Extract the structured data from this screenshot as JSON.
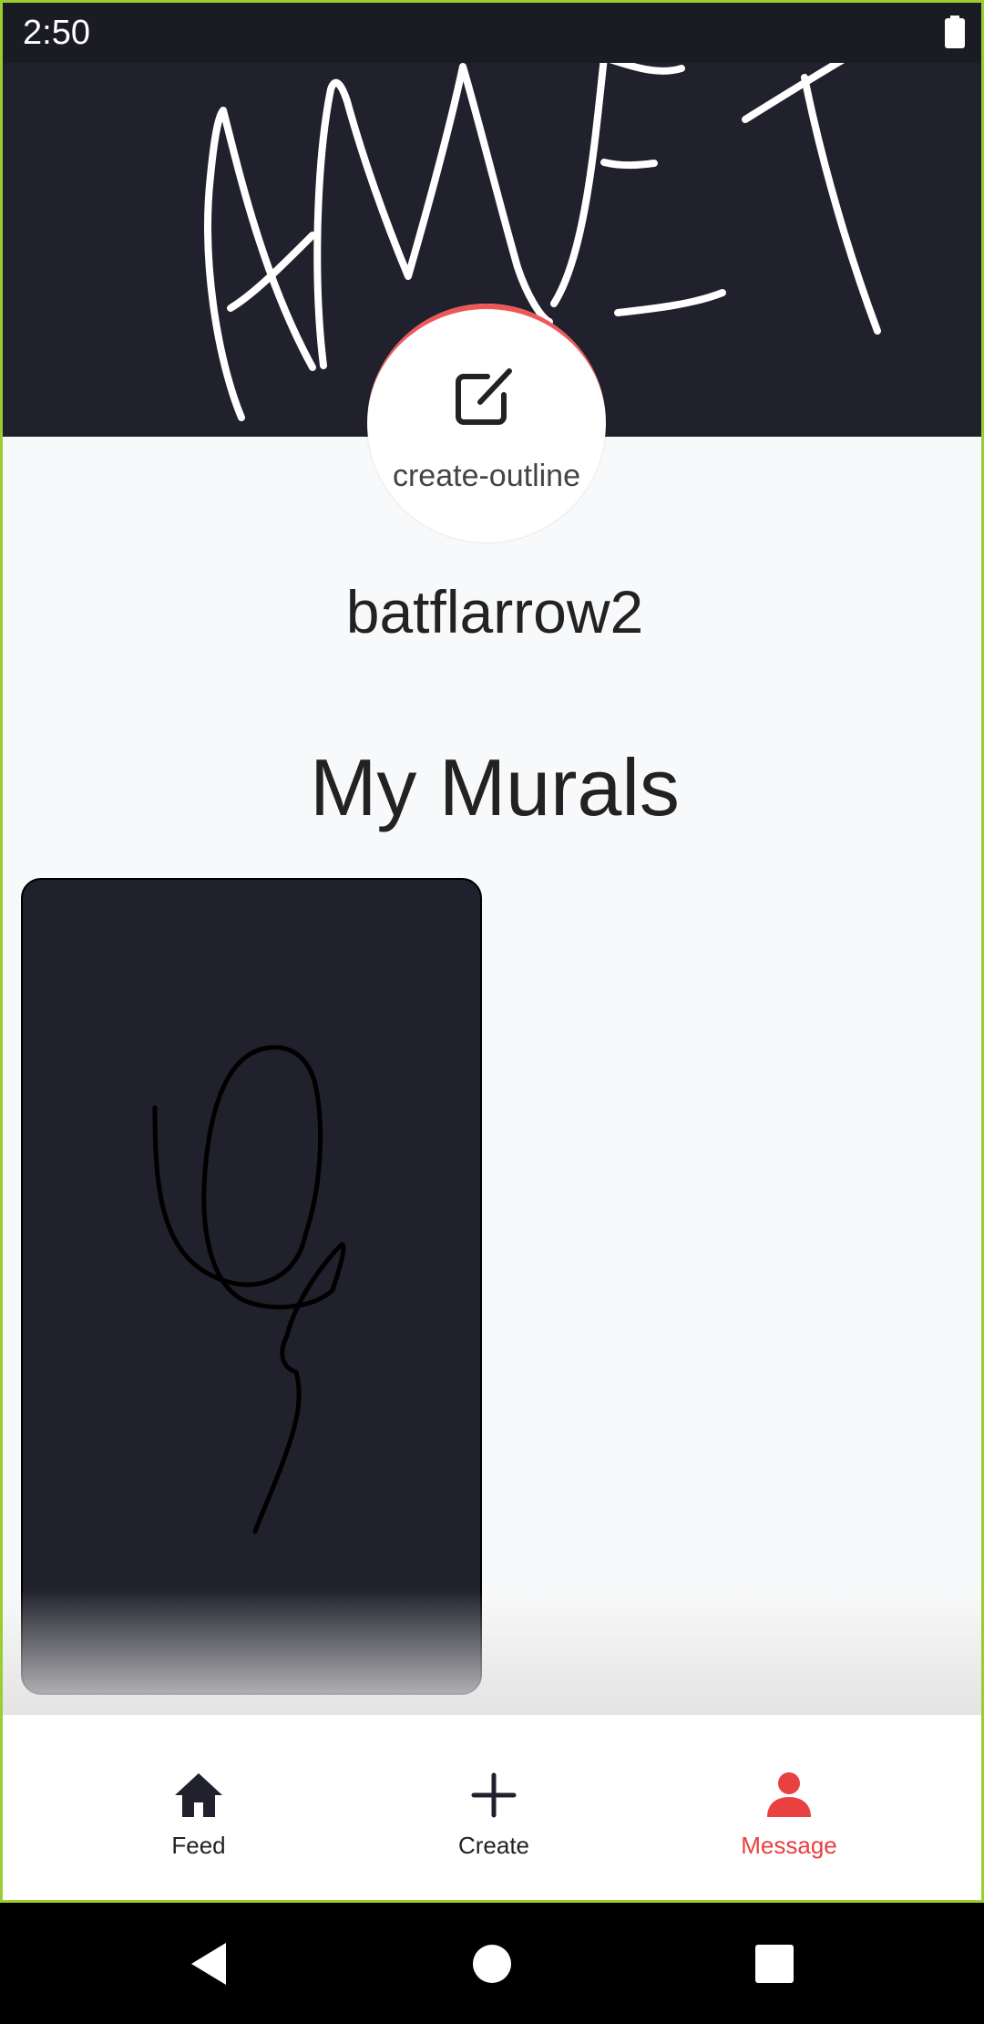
{
  "status_bar": {
    "time": "2:50",
    "battery_icon": "battery-full-icon"
  },
  "banner": {
    "drawing_text": "AMIT"
  },
  "profile": {
    "avatar_icon": "create-outline-icon",
    "avatar_label": "create-outline",
    "username": "batflarrow2"
  },
  "murals": {
    "title": "My Murals",
    "count": 1
  },
  "bottom_nav": {
    "items": [
      {
        "label": "Feed",
        "icon": "home-icon",
        "active": false
      },
      {
        "label": "Create",
        "icon": "plus-icon",
        "active": false
      },
      {
        "label": "Message",
        "icon": "person-icon",
        "active": true
      }
    ]
  },
  "system_nav": {
    "icons": [
      "back-icon",
      "home-circle-icon",
      "recents-icon"
    ]
  },
  "colors": {
    "banner_bg": "#20212c",
    "page_bg": "#f8f9fa",
    "accent": "#e94040",
    "frame_border": "#9acd32"
  }
}
